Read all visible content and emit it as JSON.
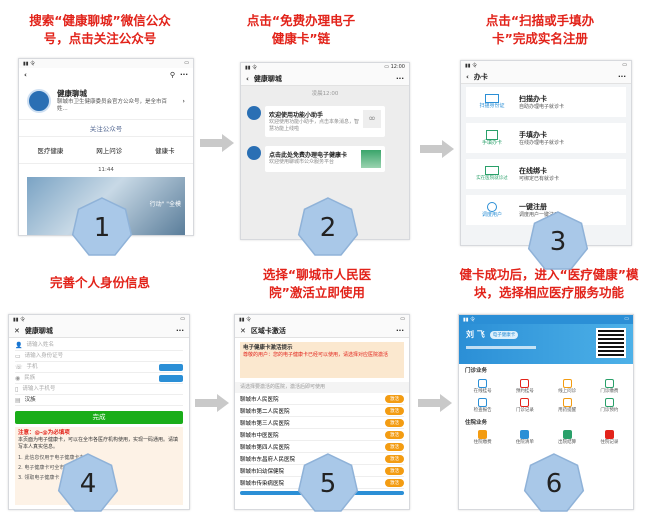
{
  "captions": {
    "step1": "搜索“健康聊城”微信公众号，点击关注公众号",
    "step2": "点击“免费办理电子健康卡”链",
    "step3": "点击“扫描或手填办卡”完成实名注册",
    "step4": "完善个人身份信息",
    "step5": "选择“聊城市人民医院”激活立即使用",
    "step6": "健卡成功后，进入“医疗健康”模块，选择相应医疗服务功能"
  },
  "step_numbers": [
    "1",
    "2",
    "3",
    "4",
    "5",
    "6"
  ],
  "screen1": {
    "account_name": "健康聊城",
    "description": "聊城市卫生健康委员会官方公众号，是全市百姓...",
    "follow_label": "关注公众号",
    "menu": [
      "医疗健康",
      "网上问诊",
      "健康卡"
    ],
    "timestamp": "11:44",
    "banner_text": "行动\" \"全模"
  },
  "screen2": {
    "title": "健康聊城",
    "time": "凌晨12:00",
    "msg1_title": "欢迎使用功能小助手",
    "msg1_body": "欢迎使用功能小助手，点击本条消息，智慧功能上线啦",
    "msg2_title": "点击此处免费办理电子健康卡",
    "msg2_body": "欢迎使用聊城市公众服务平台"
  },
  "screen3": {
    "title": "办卡",
    "options": [
      {
        "tag": "扫描身份证",
        "title": "扫描办卡",
        "sub": "自助办理电子就诊卡"
      },
      {
        "tag": "手填办卡",
        "title": "手填办卡",
        "sub": "在线办理电子就诊卡"
      },
      {
        "tag": "实在医院就诊过",
        "title": "在线绑卡",
        "sub": "可绑定已有就诊卡"
      },
      {
        "tag": "调度用户",
        "title": "一键注册",
        "sub": "调度用户一键注册"
      }
    ]
  },
  "screen4": {
    "title": "健康聊城",
    "fields": [
      {
        "placeholder": "请输入姓名"
      },
      {
        "placeholder": "请输入身份证号"
      },
      {
        "placeholder": "手机"
      },
      {
        "placeholder": "民族"
      },
      {
        "placeholder": "请输入手机号"
      },
      {
        "placeholder": "汉族"
      }
    ],
    "submit_label": "完成",
    "notice_title": "注意：@-@为必填项",
    "notice_body": "本页面为电子健康卡，可以在全市各医疗机构使用，实现一码通用。请填写本人真实信息。",
    "notice_list": [
      "1. 此信息仅用于电子健康卡办理",
      "2. 电子健康卡可全市通用",
      "3. 领取电子健康卡"
    ]
  },
  "screen5": {
    "title": "区域卡激活",
    "tip_title": "电子健康卡激活提示",
    "tip_body": "尊敬的用户：您的电子健康卡已经可以使用，请选择对应医院激活",
    "hint": "请选择要激活的医院，激活后即可使用",
    "hospitals": [
      "聊城市人民医院",
      "聊城市第二人民医院",
      "聊城市第三人民医院",
      "聊城市中医医院",
      "聊城市第四人民医院",
      "聊城市东昌府人民医院",
      "聊城市妇幼保健院",
      "聊城市传染病医院"
    ],
    "action": "激活"
  },
  "screen6": {
    "name": "刘 飞",
    "card_label": "电子健康卡",
    "section1": "门诊业务",
    "services": [
      "在线挂号",
      "预约挂号",
      "线上问诊",
      "门诊缴费",
      "检查报告",
      "门诊记录",
      "用药提醒",
      "门诊预约"
    ],
    "section2": "住院业务",
    "services2": [
      "住院缴费",
      "住院清单",
      "出院结算",
      "住院记录"
    ]
  },
  "colors": {
    "caption": "#e2231a",
    "heptagon_fill": "#a9c8e8",
    "heptagon_stroke": "#8fb2d8",
    "arrow": "#bfbfbf",
    "wechat_green": "#1aad19",
    "card_blue": "#2b8fd6"
  }
}
